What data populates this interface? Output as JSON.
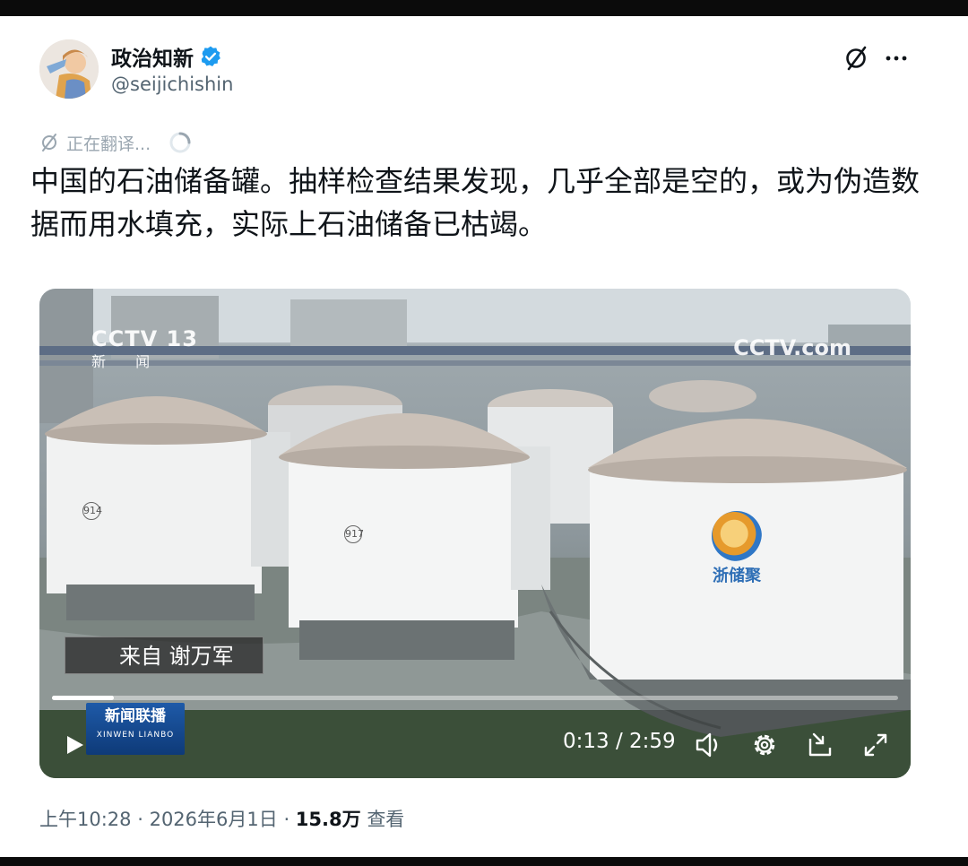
{
  "author": {
    "name": "政治知新",
    "handle": "@seijichishin",
    "verified": true
  },
  "header_icons": [
    "translate-icon",
    "more-icon"
  ],
  "translating": {
    "label": "正在翻译..."
  },
  "tweet": {
    "text": "中国的石油储备罐。抽样检查结果发现，几乎全部是空的，或为伪造数据而用水填充，实际上石油储备已枯竭。"
  },
  "video": {
    "channel_logo": "CCTV 13",
    "channel_sub": "新 闻",
    "site_watermark": "CCTV.com",
    "tank_numbers": [
      "914",
      "917"
    ],
    "tank_logo_text": "浙储聚",
    "caption": "来自 谢万军",
    "program_logo": "新闻联播",
    "program_logo_pinyin": "XINWEN LIANBO",
    "time_display": "0:13 / 2:59",
    "progress_fraction": 0.073,
    "accent_color": "#ffffff"
  },
  "meta": {
    "time": "上午10:28",
    "date": "2026年6月1日",
    "views": "15.8万",
    "views_label": "查看"
  }
}
